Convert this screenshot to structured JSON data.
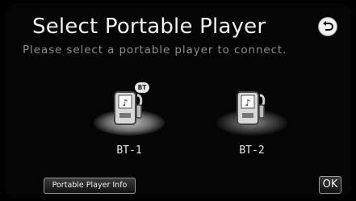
{
  "header": {
    "title": "Select Portable Player",
    "subtitle": "Please select a portable player to connect."
  },
  "devices": [
    {
      "label": "BT-1",
      "badge": "BT",
      "state": "connected"
    },
    {
      "label": "BT-2",
      "badge": "",
      "state": "available"
    }
  ],
  "footer": {
    "info_label": "Portable Player Info",
    "ok_label": "OK"
  },
  "icons": {
    "back": "back-arrow-icon",
    "device": "portable-music-player-icon"
  },
  "colors": {
    "background": "#000000",
    "text": "#f2f2f2",
    "subtitle": "#8e8e8e"
  }
}
